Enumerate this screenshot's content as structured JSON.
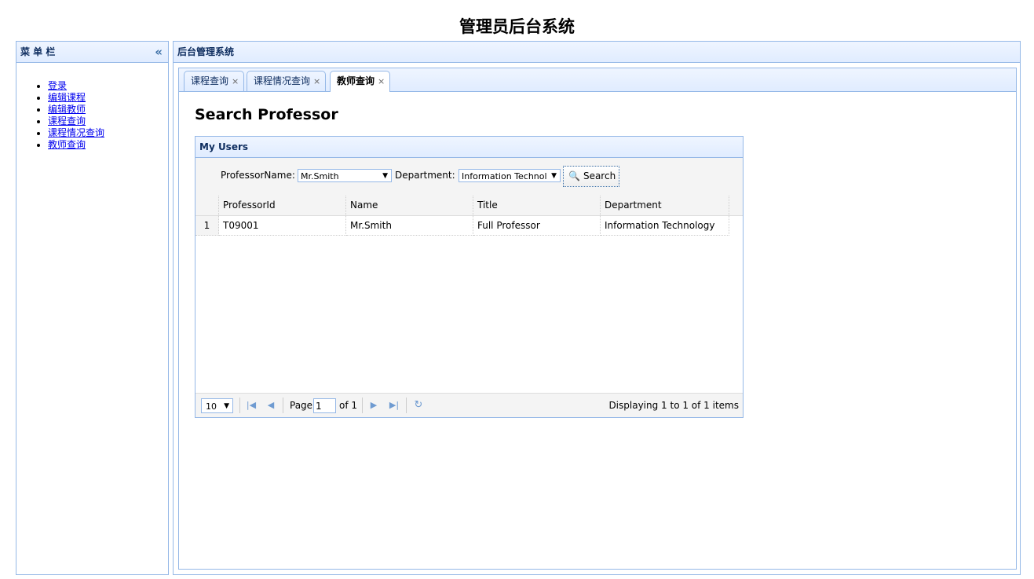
{
  "page_title": "管理员后台系统",
  "menu": {
    "title": "菜 单 栏",
    "collapse_icon": "«",
    "items": [
      "登录",
      "编辑课程",
      "编辑教师",
      "课程查询",
      "课程情况查询",
      "教师查询"
    ]
  },
  "main": {
    "title": "后台管理系统",
    "tabs": [
      {
        "label": "课程查询",
        "close": "×"
      },
      {
        "label": "课程情况查询",
        "close": "×"
      },
      {
        "label": "教师查询",
        "close": "×",
        "active": true
      }
    ],
    "content_title": "Search Professor",
    "grid": {
      "title": "My Users",
      "professor_name_label": "ProfessorName:",
      "professor_name_value": "Mr.Smith",
      "department_label": "Department:",
      "department_value": "Information Technol",
      "search_label": "Search",
      "columns": [
        "ProfessorId",
        "Name",
        "Title",
        "Department"
      ],
      "rows": [
        {
          "num": "1",
          "id": "T09001",
          "name": "Mr.Smith",
          "title": "Full Professor",
          "department": "Information Technology"
        }
      ],
      "pager": {
        "page_size": "10",
        "page_label": "Page",
        "page_value": "1",
        "of_label": "of 1",
        "info": "Displaying 1 to 1 of 1 items"
      }
    }
  },
  "colors": {
    "border": "#95b8e7",
    "header_text": "#0e2d5f",
    "link": "#0000ee"
  }
}
